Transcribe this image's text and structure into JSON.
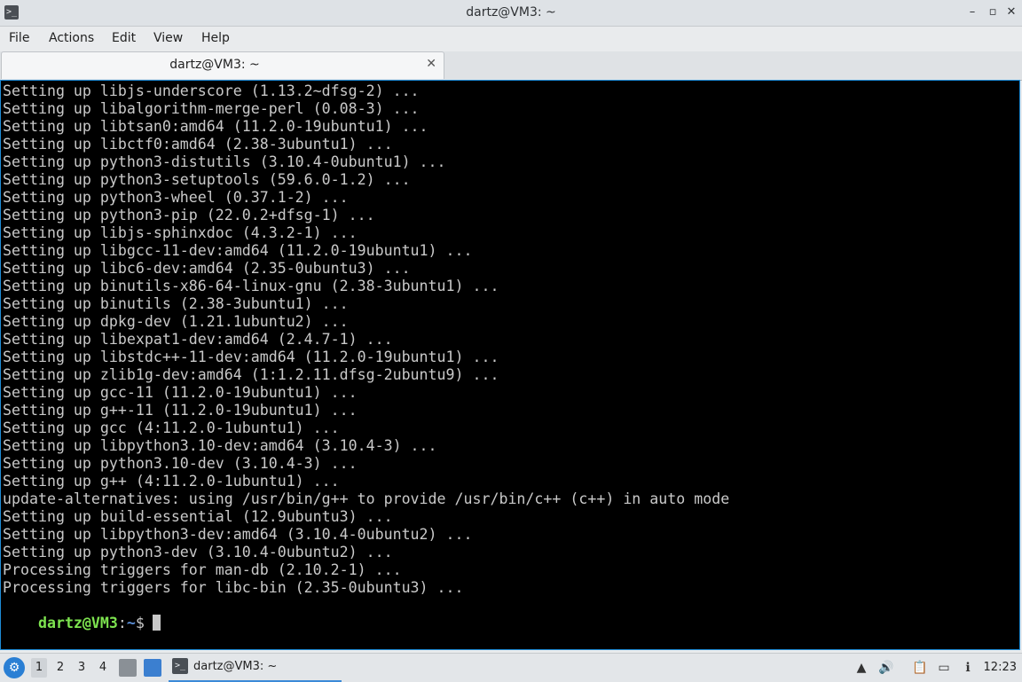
{
  "window": {
    "title": "dartz@VM3: ~",
    "app_icon": "terminal-icon",
    "controls": {
      "minimize": "–",
      "maximize": "▫",
      "close": "✕"
    }
  },
  "menu": {
    "items": [
      "File",
      "Actions",
      "Edit",
      "View",
      "Help"
    ]
  },
  "tabs": [
    {
      "label": "dartz@VM3: ~",
      "close": "✕"
    }
  ],
  "terminal": {
    "lines": [
      "Setting up libjs-underscore (1.13.2~dfsg-2) ...",
      "Setting up libalgorithm-merge-perl (0.08-3) ...",
      "Setting up libtsan0:amd64 (11.2.0-19ubuntu1) ...",
      "Setting up libctf0:amd64 (2.38-3ubuntu1) ...",
      "Setting up python3-distutils (3.10.4-0ubuntu1) ...",
      "Setting up python3-setuptools (59.6.0-1.2) ...",
      "Setting up python3-wheel (0.37.1-2) ...",
      "Setting up python3-pip (22.0.2+dfsg-1) ...",
      "Setting up libjs-sphinxdoc (4.3.2-1) ...",
      "Setting up libgcc-11-dev:amd64 (11.2.0-19ubuntu1) ...",
      "Setting up libc6-dev:amd64 (2.35-0ubuntu3) ...",
      "Setting up binutils-x86-64-linux-gnu (2.38-3ubuntu1) ...",
      "Setting up binutils (2.38-3ubuntu1) ...",
      "Setting up dpkg-dev (1.21.1ubuntu2) ...",
      "Setting up libexpat1-dev:amd64 (2.4.7-1) ...",
      "Setting up libstdc++-11-dev:amd64 (11.2.0-19ubuntu1) ...",
      "Setting up zlib1g-dev:amd64 (1:1.2.11.dfsg-2ubuntu9) ...",
      "Setting up gcc-11 (11.2.0-19ubuntu1) ...",
      "Setting up g++-11 (11.2.0-19ubuntu1) ...",
      "Setting up gcc (4:11.2.0-1ubuntu1) ...",
      "Setting up libpython3.10-dev:amd64 (3.10.4-3) ...",
      "Setting up python3.10-dev (3.10.4-3) ...",
      "Setting up g++ (4:11.2.0-1ubuntu1) ...",
      "update-alternatives: using /usr/bin/g++ to provide /usr/bin/c++ (c++) in auto mode",
      "Setting up build-essential (12.9ubuntu3) ...",
      "Setting up libpython3-dev:amd64 (3.10.4-0ubuntu2) ...",
      "Setting up python3-dev (3.10.4-0ubuntu2) ...",
      "Processing triggers for man-db (2.10.2-1) ...",
      "Processing triggers for libc-bin (2.35-0ubuntu3) ..."
    ],
    "prompt": {
      "user_host": "dartz@VM3",
      "separator": ":",
      "path": "~",
      "symbol": "$"
    }
  },
  "taskbar": {
    "start_icon": "lxqt-start-icon",
    "workspaces": [
      "1",
      "2",
      "3",
      "4"
    ],
    "active_workspace": "1",
    "task": {
      "label": "dartz@VM3: ~"
    },
    "tray": [
      "tray-arrow-icon",
      "volume-icon",
      "clipboard-icon",
      "network-icon",
      "notification-icon"
    ],
    "clock": "12:23"
  },
  "colors": {
    "terminal_bg": "#000000",
    "terminal_fg": "#c9c9c9",
    "prompt_user": "#7de34f",
    "prompt_path": "#5b8fd8",
    "accent": "#1e8bd6"
  }
}
